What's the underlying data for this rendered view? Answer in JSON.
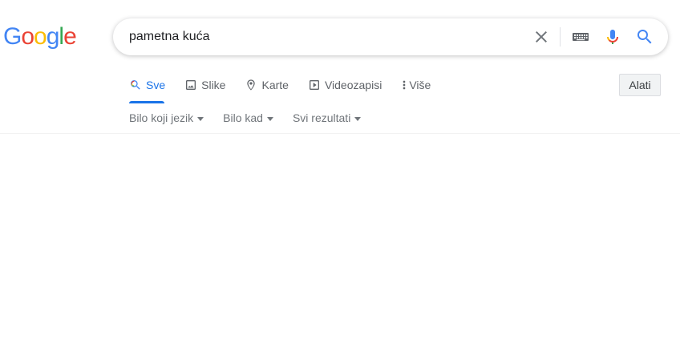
{
  "logo": {
    "letters": [
      "G",
      "o",
      "o",
      "g",
      "l",
      "e"
    ],
    "colors": [
      "#4285F4",
      "#EA4335",
      "#FBBC05",
      "#4285F4",
      "#34A853",
      "#EA4335"
    ]
  },
  "search": {
    "query": "pametna kuća",
    "icons": [
      "clear-icon",
      "keyboard-icon",
      "microphone-icon",
      "search-icon"
    ]
  },
  "tabs": [
    {
      "label": "Sve",
      "icon": "search-icon",
      "active": true
    },
    {
      "label": "Slike",
      "icon": "image-icon",
      "active": false
    },
    {
      "label": "Karte",
      "icon": "map-pin-icon",
      "active": false
    },
    {
      "label": "Videozapisi",
      "icon": "play-icon",
      "active": false
    },
    {
      "label": "Više",
      "icon": "more-vertical-icon",
      "active": false
    }
  ],
  "tools_label": "Alati",
  "filters": [
    {
      "label": "Bilo koji jezik"
    },
    {
      "label": "Bilo kad"
    },
    {
      "label": "Svi rezultati"
    }
  ],
  "colors": {
    "accent": "#1a73e8",
    "text_secondary": "#5f6368"
  }
}
